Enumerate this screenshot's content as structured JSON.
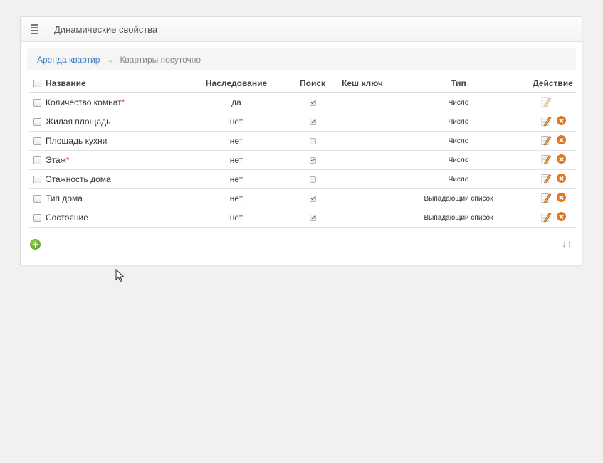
{
  "panel": {
    "title": "Динамические свойства",
    "menu_icon": "list-icon"
  },
  "breadcrumb": {
    "items": [
      {
        "label": "Аренда квартир",
        "link": true
      },
      {
        "label": "Квартиры посуточно",
        "link": false
      }
    ],
    "separator": "→"
  },
  "table": {
    "headers": {
      "name": "Название",
      "inherit": "Наследование",
      "search": "Поиск",
      "cache": "Кеш ключ",
      "type": "Тип",
      "action": "Действие"
    },
    "rows": [
      {
        "name": "Количество комнат",
        "required": true,
        "inherit": "да",
        "search": true,
        "cache": "",
        "type": "Число",
        "deletable": false
      },
      {
        "name": "Жилая площадь",
        "required": false,
        "inherit": "нет",
        "search": true,
        "cache": "",
        "type": "Число",
        "deletable": true
      },
      {
        "name": "Площадь кухни",
        "required": false,
        "inherit": "нет",
        "search": false,
        "cache": "",
        "type": "Число",
        "deletable": true
      },
      {
        "name": "Этаж",
        "required": true,
        "inherit": "нет",
        "search": true,
        "cache": "",
        "type": "Число",
        "deletable": true
      },
      {
        "name": "Этажность дома",
        "required": false,
        "inherit": "нет",
        "search": false,
        "cache": "",
        "type": "Число",
        "deletable": true
      },
      {
        "name": "Тип дома",
        "required": false,
        "inherit": "нет",
        "search": true,
        "cache": "",
        "type": "Выпадающий список",
        "deletable": true
      },
      {
        "name": "Состояние",
        "required": false,
        "inherit": "нет",
        "search": true,
        "cache": "",
        "type": "Выпадающий список",
        "deletable": true
      }
    ],
    "required_mark": "*"
  },
  "footer": {
    "add_icon": "plus-circle-icon",
    "sort_label": "↓↑"
  },
  "colors": {
    "link": "#3a7dbf",
    "delete": "#e3761a",
    "add": "#4a9a1c",
    "required": "#d9534f"
  }
}
